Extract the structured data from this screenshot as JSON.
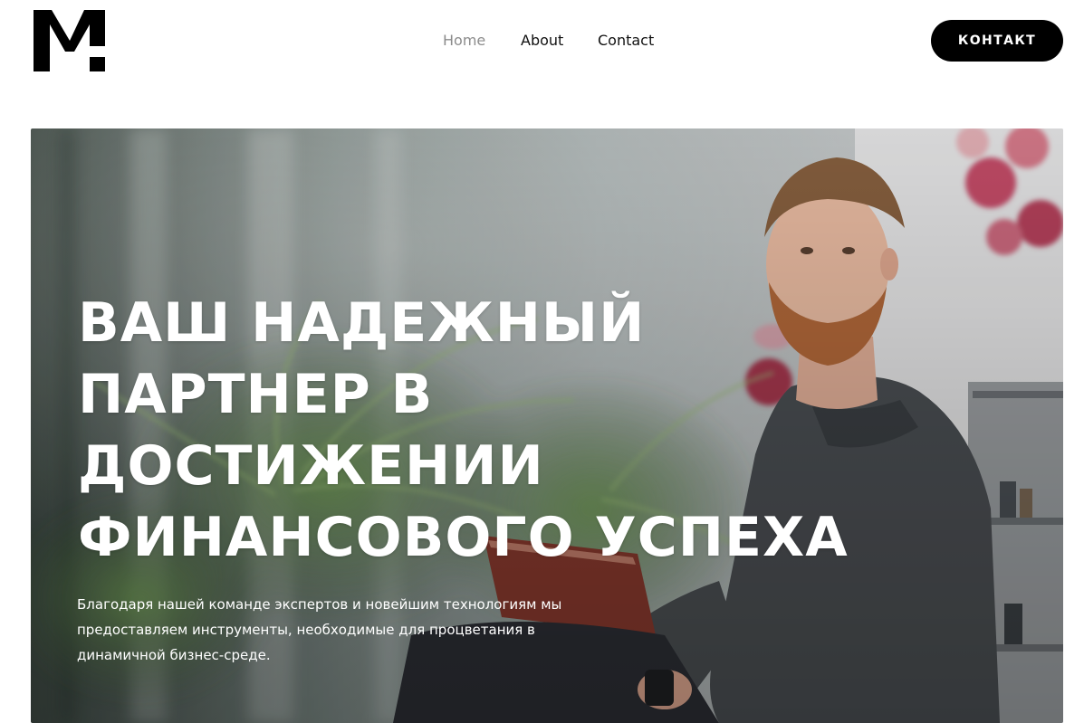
{
  "header": {
    "logo_text": "M",
    "nav": [
      {
        "label": "Home"
      },
      {
        "label": "About"
      },
      {
        "label": "Contact"
      }
    ],
    "cta_label": "КОНТАКТ"
  },
  "hero": {
    "title_lines": [
      "ВАШ НАДЕЖНЫЙ",
      "ПАРТНЕР В",
      "ДОСТИЖЕНИИ",
      "ФИНАНСОВОГО УСПЕХА"
    ],
    "subtitle": "Благодаря нашей команде экспертов и новейшим технологиям мы предоставляем инструменты, необходимые для процветания в динамичной бизнес-среде."
  },
  "colors": {
    "cta_background": "#000000",
    "nav_active": "#8c8c8c",
    "nav_default": "#111111"
  }
}
